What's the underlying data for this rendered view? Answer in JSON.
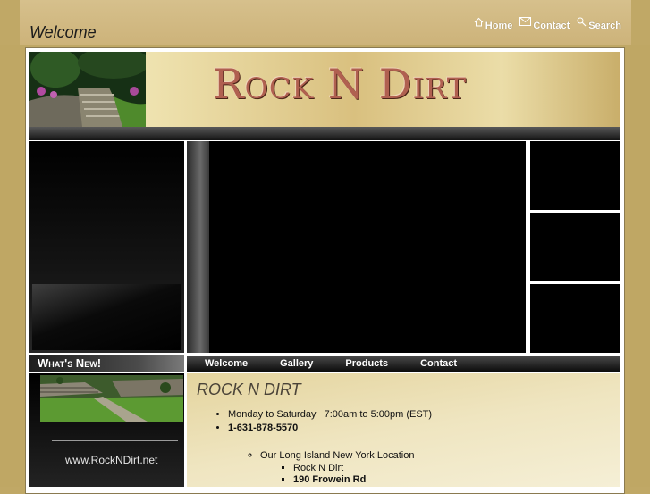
{
  "page": {
    "title": "Welcome"
  },
  "top_nav": [
    {
      "label": "Home",
      "icon": "home-icon"
    },
    {
      "label": "Contact",
      "icon": "mail-icon"
    },
    {
      "label": "Search",
      "icon": "search-icon"
    }
  ],
  "header": {
    "logo_text": "Rock N Dirt"
  },
  "sidebar": {
    "heading": "What's New!",
    "url_text": "www.RockNDirt.net"
  },
  "main_nav": [
    {
      "label": "Welcome"
    },
    {
      "label": "Gallery"
    },
    {
      "label": "Products"
    },
    {
      "label": "Contact"
    }
  ],
  "content": {
    "title": "ROCK N DIRT",
    "hours": "Monday to Saturday   7:00am to 5:00pm (EST)",
    "phone": "1-631-878-5570",
    "location_heading": "Our Long Island New York Location",
    "location_lines": [
      "Rock N Dirt",
      "190 Frowein Rd"
    ]
  },
  "colors": {
    "background": "#c0a866",
    "header_logo": "#b06050",
    "panel": "#000000"
  }
}
